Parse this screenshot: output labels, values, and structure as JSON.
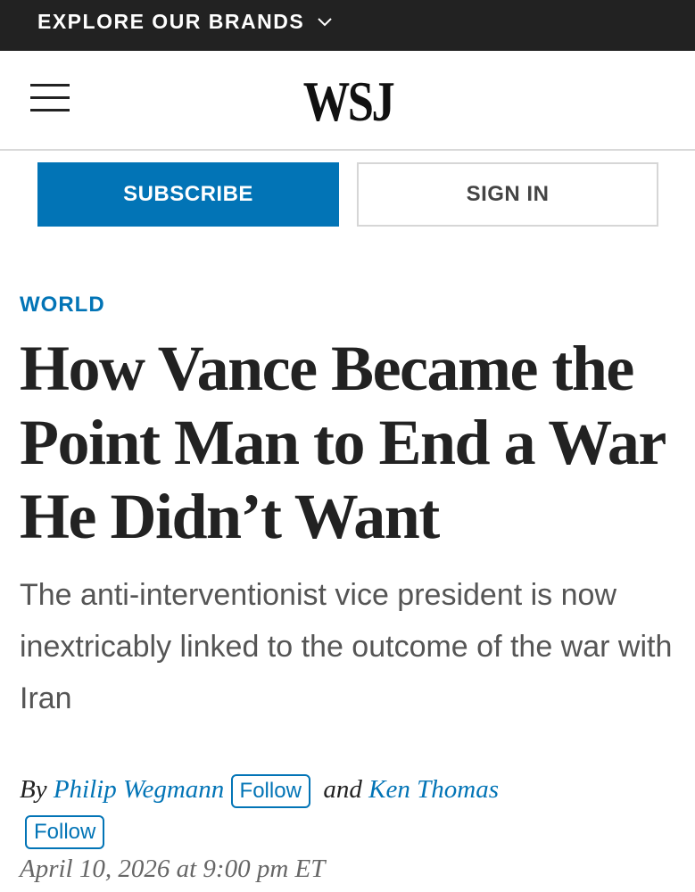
{
  "topbar": {
    "brands_label": "EXPLORE OUR BRANDS",
    "chevron_icon": "chevron-down-icon"
  },
  "masthead": {
    "menu_icon": "hamburger-menu-icon",
    "logo": "WSJ"
  },
  "actions": {
    "subscribe_label": "SUBSCRIBE",
    "signin_label": "SIGN IN"
  },
  "article": {
    "section": "WORLD",
    "headline": "How Vance Became the Point Man to End a War He Didn’t Want",
    "dek": "The anti-interventionist vice president is now inextricably linked to the outcome of the war with Iran",
    "byline": {
      "by": "By",
      "author1": "Philip Wegmann",
      "follow1": "Follow",
      "and": "and",
      "author2": "Ken Thomas",
      "follow2": "Follow"
    },
    "date": "April 10, 2026 at 9:00 pm ET"
  },
  "colors": {
    "accent": "#0274b6",
    "topbar": "#222222"
  }
}
